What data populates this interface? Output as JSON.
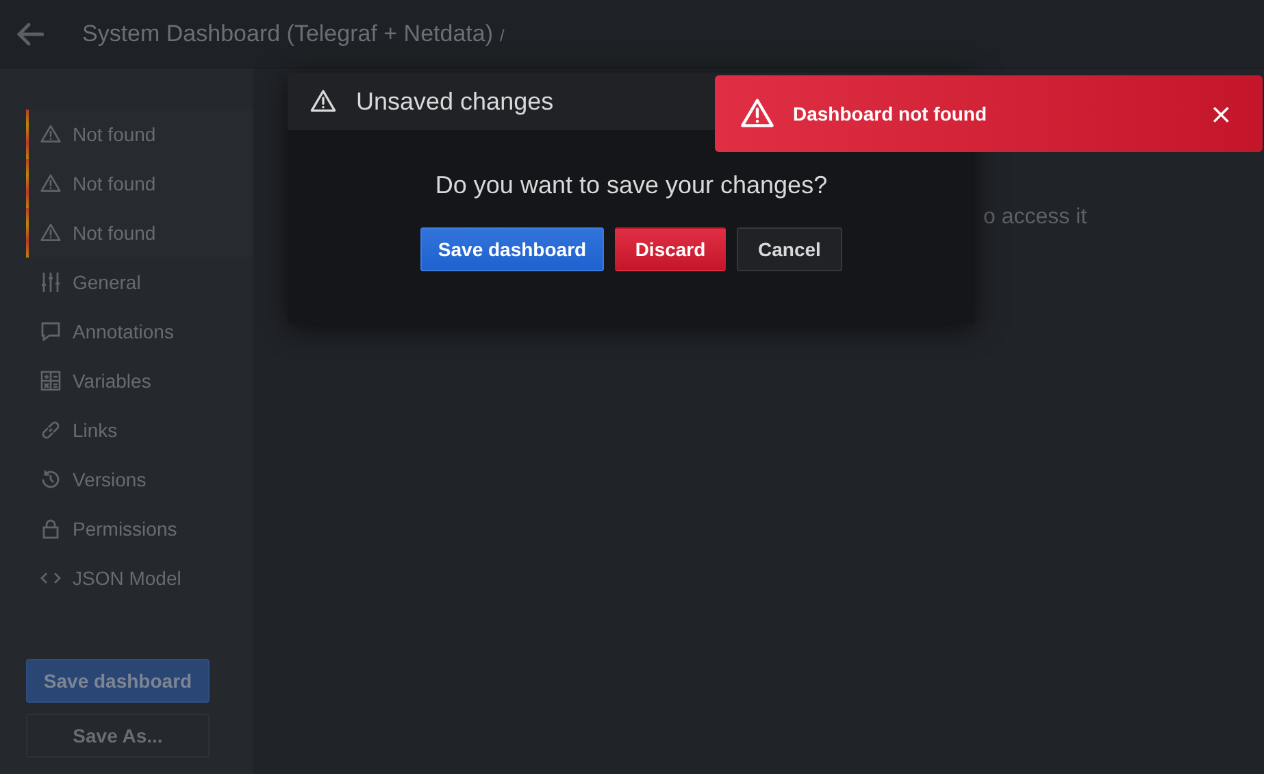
{
  "top_bar": {
    "title": "System Dashboard (Telegraf + Netdata)",
    "separator": "/"
  },
  "sidebar": {
    "items": [
      {
        "label": "Not found",
        "kind": "error"
      },
      {
        "label": "Not found",
        "kind": "error"
      },
      {
        "label": "Not found",
        "kind": "error"
      },
      {
        "label": "General",
        "kind": "link"
      },
      {
        "label": "Annotations",
        "kind": "link"
      },
      {
        "label": "Variables",
        "kind": "link"
      },
      {
        "label": "Links",
        "kind": "link"
      },
      {
        "label": "Versions",
        "kind": "link"
      },
      {
        "label": "Permissions",
        "kind": "link"
      },
      {
        "label": "JSON Model",
        "kind": "link"
      }
    ],
    "buttons": [
      {
        "label": "Save dashboard",
        "kind": "primary"
      },
      {
        "label": "Save As...",
        "kind": "secondary"
      }
    ]
  },
  "main": {
    "message": "o access it"
  },
  "modal": {
    "title": "Unsaved changes",
    "question": "Do you want to save your changes?",
    "buttons": [
      {
        "label": "Save dashboard",
        "kind": "primary"
      },
      {
        "label": "Discard",
        "kind": "destructive"
      },
      {
        "label": "Cancel",
        "kind": "secondary"
      }
    ]
  },
  "toast": {
    "message": "Dashboard not found",
    "close": "×"
  }
}
